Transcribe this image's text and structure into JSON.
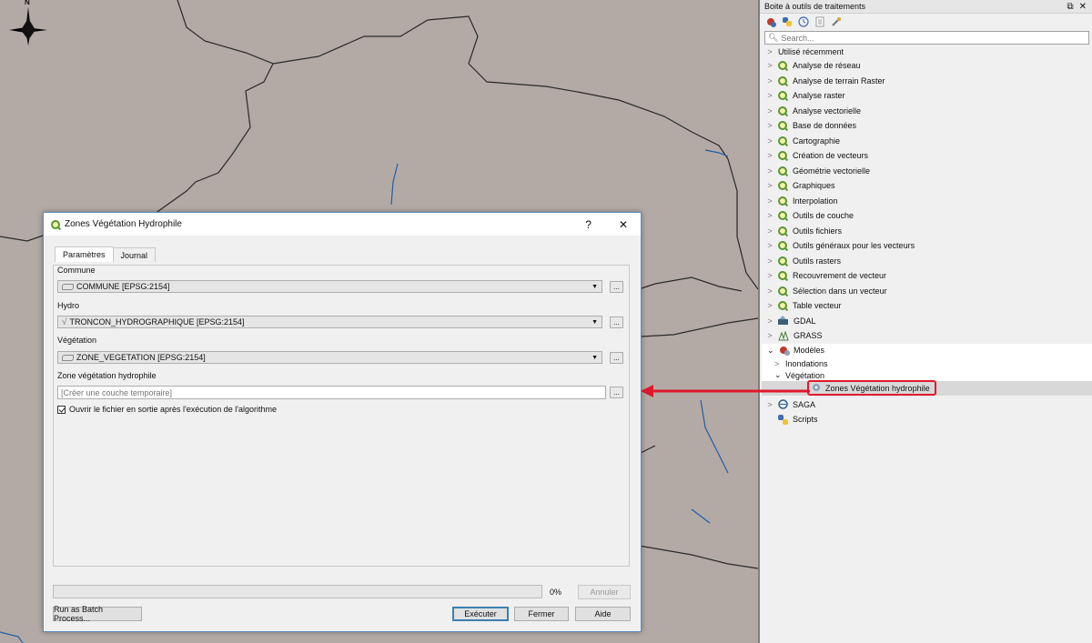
{
  "compass": {
    "label": "N"
  },
  "toolbox": {
    "title": "Boite à outils de traitements",
    "search_placeholder": "Search...",
    "recent": "Utilisé récemment",
    "providers": [
      "Analyse de réseau",
      "Analyse de terrain Raster",
      "Analyse raster",
      "Analyse vectorielle",
      "Base de données",
      "Cartographie",
      "Création de vecteurs",
      "Géométrie vectorielle",
      "Graphiques",
      "Interpolation",
      "Outils de couche",
      "Outils fichiers",
      "Outils généraux pour les vecteurs",
      "Outils rasters",
      "Recouvrement de vecteur",
      "Sélection dans un vecteur",
      "Table vecteur"
    ],
    "gdal": "GDAL",
    "grass": "GRASS",
    "models": "Modèles",
    "model_groups": {
      "inondations": "Inondations",
      "vegetation": "Végétation"
    },
    "selected_model": "Zones Végétation hydrophile",
    "saga": "SAGA",
    "scripts": "Scripts"
  },
  "dialog": {
    "title": "Zones Végétation Hydrophile",
    "help_glyph": "?",
    "close_glyph": "✕",
    "tabs": [
      "Paramètres",
      "Journal"
    ],
    "params": {
      "commune_label": "Commune",
      "commune_value": "COMMUNE [EPSG:2154]",
      "hydro_label": "Hydro",
      "hydro_value": "TRONCON_HYDROGRAPHIQUE [EPSG:2154]",
      "vegetation_label": "Végétation",
      "vegetation_value": "ZONE_VEGETATION [EPSG:2154]",
      "output_label": "Zone végétation hydrophile",
      "output_placeholder": "[Créer une couche temporaire]",
      "open_output_label": "Ouvrir le fichier en sortie après l'exécution de l'algorithme",
      "ellipsis": "..."
    },
    "progress": "0%",
    "buttons": {
      "cancel": "Annuler",
      "batch": "Run as Batch Process...",
      "run": "Exécuter",
      "close": "Fermer",
      "help": "Aide"
    }
  }
}
